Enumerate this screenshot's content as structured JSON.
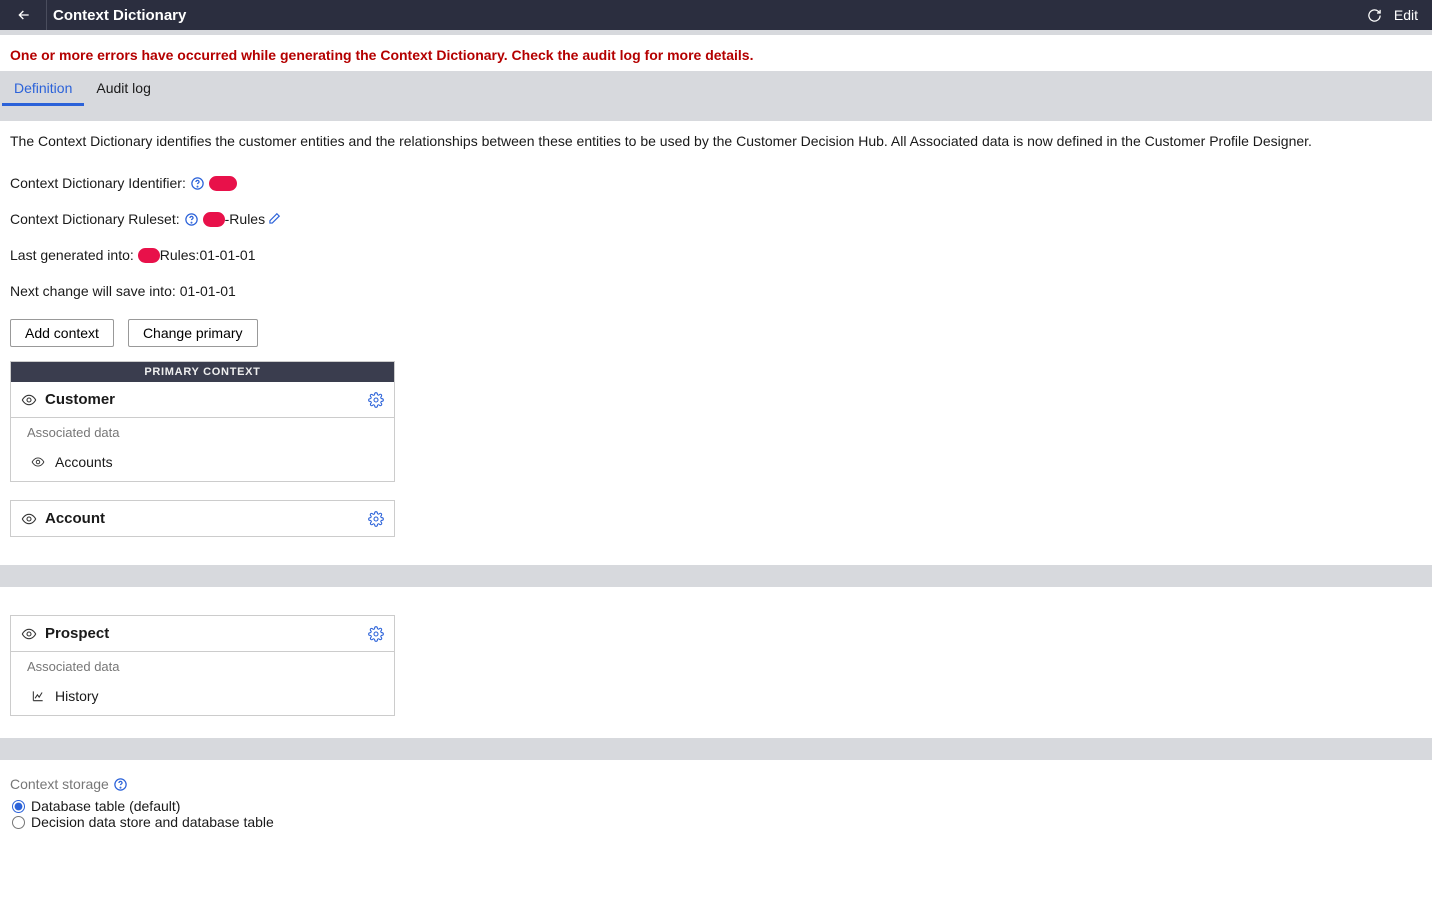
{
  "header": {
    "title": "Context Dictionary",
    "edit_label": "Edit"
  },
  "error_message": "One or more errors have occurred while generating the Context Dictionary. Check the audit log for more details.",
  "tabs": [
    {
      "label": "Definition",
      "active": true
    },
    {
      "label": "Audit log",
      "active": false
    }
  ],
  "description": "The Context Dictionary identifies the customer entities and the relationships between these entities to be used by the Customer Decision Hub. All Associated data is now defined in the Customer Profile Designer.",
  "fields": {
    "identifier_label": "Context Dictionary Identifier:",
    "identifier_value_redacted": true,
    "ruleset_label": "Context Dictionary Ruleset:",
    "ruleset_value_suffix": "-Rules",
    "last_gen_label": "Last generated into:",
    "last_gen_value_suffix": "Rules:01-01-01",
    "next_save_label": "Next change will save into:",
    "next_save_value": "01-01-01"
  },
  "buttons": {
    "add_context": "Add context",
    "change_primary": "Change primary"
  },
  "primary_context_header": "PRIMARY CONTEXT",
  "cards": {
    "customer": {
      "title": "Customer",
      "associated_label": "Associated data",
      "items": [
        "Accounts"
      ]
    },
    "account": {
      "title": "Account"
    },
    "prospect": {
      "title": "Prospect",
      "associated_label": "Associated data",
      "items": [
        "History"
      ]
    }
  },
  "storage": {
    "label": "Context storage",
    "options": [
      {
        "label": "Database table (default)",
        "selected": true
      },
      {
        "label": "Decision data store and database table",
        "selected": false
      }
    ]
  }
}
